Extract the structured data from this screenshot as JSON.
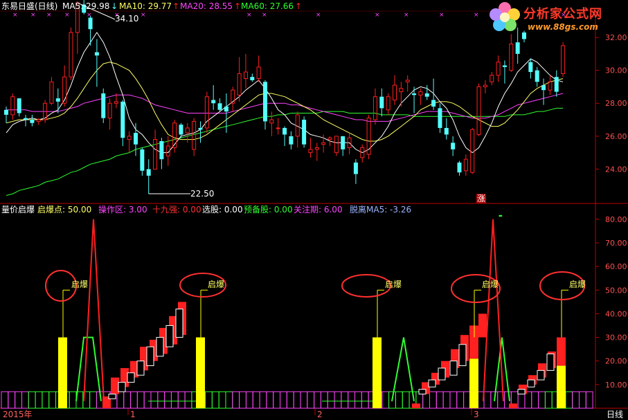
{
  "header": {
    "title": "东易日盛(日线)",
    "ma5": "MA5: 29.98",
    "ma10": "MA10: 29.77",
    "ma20": "MA20: 28.55",
    "ma60": "MA60: 27.66",
    "arrow_down": "↓",
    "arrow_up": "↑"
  },
  "logo": {
    "text": "分析家公式网",
    "url": "www.88gs.com"
  },
  "indicator_header": {
    "name": "量价启爆",
    "qibaodian": "启爆点: 50.00",
    "caozuoqu": "操作区: 3.00",
    "shijiuqiang": "十九强: 0.00",
    "xuangu": "选股: 0.00",
    "yubeigu": "预备股: 0.00",
    "guanzhuqi": "关注期: 6.00",
    "tuoli": "脱离MA5: -3.26"
  },
  "price_annotations": {
    "high": "34.10",
    "low": "22.50",
    "zhang": "涨"
  },
  "qibao_label": "启爆",
  "x_axis": {
    "year": "2015年",
    "m1": "1",
    "m2": "2",
    "m3": "3",
    "period": "日线"
  },
  "colors": {
    "up": "#ff2020",
    "down": "#54ffff",
    "ma5": "#ffffff",
    "ma10": "#ffff66",
    "ma20": "#ff44ff",
    "ma60": "#30ff30",
    "axis": "#c00000",
    "yellow": "#ffff00",
    "ring": "#ff3030"
  },
  "chart_data": [
    {
      "type": "candlestick",
      "yaxis": [
        "24.00",
        "26.00",
        "28.00",
        "30.00",
        "32.00"
      ],
      "ylim": [
        22,
        33.6
      ],
      "bars": [
        [
          27.6,
          27.8,
          26.8,
          27.3
        ],
        [
          27.3,
          28.6,
          27.0,
          28.4
        ],
        [
          28.3,
          28.3,
          27.2,
          27.4
        ],
        [
          27.1,
          27.3,
          26.6,
          27.0
        ],
        [
          27.0,
          27.3,
          26.6,
          26.8
        ],
        [
          26.9,
          27.1,
          26.7,
          27.0
        ],
        [
          27.0,
          28.2,
          26.8,
          28.0
        ],
        [
          28.0,
          29.6,
          27.9,
          29.3
        ],
        [
          28.3,
          28.9,
          27.4,
          28.1
        ],
        [
          28.0,
          30.3,
          27.8,
          29.6
        ],
        [
          29.6,
          32.6,
          29.4,
          32.3
        ],
        [
          32.3,
          34.2,
          31.0,
          34.1
        ],
        [
          34.0,
          34.3,
          33.4,
          33.5
        ],
        [
          33.2,
          33.3,
          31.5,
          32.5
        ],
        [
          31.1,
          31.9,
          29.0,
          30.9
        ],
        [
          28.6,
          28.9,
          26.8,
          27.1
        ],
        [
          27.1,
          28.3,
          26.4,
          28.0
        ],
        [
          28.0,
          28.6,
          27.7,
          28.1
        ],
        [
          28.1,
          28.2,
          25.4,
          25.9
        ],
        [
          25.8,
          26.3,
          25.0,
          26.0
        ],
        [
          26.2,
          26.8,
          24.8,
          25.5
        ],
        [
          25.2,
          25.3,
          23.6,
          23.9
        ],
        [
          24.0,
          24.6,
          22.5,
          23.6
        ],
        [
          24.0,
          26.4,
          24.0,
          25.8
        ],
        [
          25.7,
          25.9,
          24.0,
          24.6
        ],
        [
          24.8,
          26.0,
          24.2,
          25.4
        ],
        [
          25.3,
          27.0,
          25.0,
          26.8
        ],
        [
          26.7,
          26.8,
          25.9,
          26.1
        ],
        [
          26.2,
          26.8,
          25.6,
          26.5
        ],
        [
          25.2,
          27.1,
          24.8,
          26.9
        ],
        [
          26.5,
          26.9,
          25.6,
          26.4
        ],
        [
          26.5,
          28.7,
          26.2,
          28.4
        ],
        [
          28.2,
          29.1,
          27.6,
          28.0
        ],
        [
          28.0,
          28.3,
          27.5,
          27.6
        ],
        [
          27.8,
          28.6,
          26.2,
          27.5
        ],
        [
          28.0,
          29.0,
          27.5,
          28.8
        ],
        [
          28.5,
          30.8,
          28.1,
          29.8
        ],
        [
          29.5,
          31.0,
          28.9,
          29.9
        ],
        [
          29.6,
          29.8,
          29.3,
          29.4
        ],
        [
          29.5,
          30.9,
          29.3,
          30.2
        ],
        [
          29.3,
          29.4,
          26.4,
          26.9
        ],
        [
          26.8,
          27.5,
          26.0,
          27.0
        ],
        [
          26.5,
          27.1,
          26.1,
          26.5
        ],
        [
          26.5,
          26.6,
          25.4,
          26.1
        ],
        [
          26.0,
          26.3,
          25.2,
          25.5
        ],
        [
          26.0,
          27.5,
          25.3,
          27.3
        ],
        [
          27.0,
          27.2,
          25.3,
          25.5
        ],
        [
          25.0,
          25.9,
          24.7,
          25.2
        ],
        [
          25.2,
          25.6,
          24.5,
          25.3
        ],
        [
          25.5,
          26.1,
          25.0,
          25.6
        ],
        [
          25.8,
          26.0,
          25.4,
          25.9
        ],
        [
          25.0,
          26.0,
          24.8,
          26.0
        ],
        [
          26.0,
          25.6,
          24.8,
          25.2
        ],
        [
          25.3,
          26.2,
          24.9,
          25.9
        ],
        [
          24.4,
          24.6,
          23.1,
          23.7
        ],
        [
          24.7,
          25.5,
          24.4,
          25.3
        ],
        [
          24.9,
          27.3,
          24.6,
          27.1
        ],
        [
          27.0,
          28.9,
          26.7,
          28.4
        ],
        [
          28.4,
          28.9,
          27.2,
          27.7
        ],
        [
          27.6,
          28.6,
          27.3,
          28.4
        ],
        [
          28.2,
          29.7,
          27.9,
          29.1
        ],
        [
          28.7,
          29.3,
          27.8,
          28.9
        ],
        [
          29.3,
          29.7,
          28.7,
          29.4
        ],
        [
          28.6,
          29.0,
          27.4,
          28.5
        ],
        [
          28.5,
          28.9,
          27.9,
          28.7
        ],
        [
          28.6,
          29.1,
          28.2,
          28.4
        ],
        [
          28.2,
          29.5,
          27.6,
          27.8
        ],
        [
          27.7,
          28.0,
          26.2,
          26.5
        ],
        [
          26.5,
          27.1,
          25.8,
          26.1
        ],
        [
          25.6,
          26.0,
          24.8,
          25.2
        ],
        [
          24.4,
          24.5,
          23.6,
          23.8
        ],
        [
          23.9,
          24.9,
          23.6,
          24.6
        ],
        [
          23.8,
          26.5,
          23.7,
          26.4
        ],
        [
          26.1,
          29.2,
          26.0,
          29.0
        ],
        [
          29.0,
          29.4,
          28.6,
          29.1
        ],
        [
          29.3,
          29.9,
          29.1,
          29.7
        ],
        [
          29.7,
          30.9,
          29.3,
          30.5
        ],
        [
          30.3,
          30.6,
          29.2,
          30.2
        ],
        [
          30.0,
          32.2,
          29.9,
          31.6
        ],
        [
          31.7,
          32.6,
          30.4,
          31.0
        ],
        [
          32.3,
          32.4,
          31.7,
          31.9
        ],
        [
          30.5,
          30.7,
          29.5,
          29.9
        ],
        [
          30.0,
          30.2,
          29.0,
          29.3
        ],
        [
          29.1,
          29.5,
          27.9,
          28.8
        ],
        [
          28.8,
          29.7,
          28.5,
          29.3
        ],
        [
          29.6,
          30.0,
          28.4,
          28.7
        ],
        [
          29.8,
          31.7,
          29.6,
          31.5
        ]
      ],
      "ma5": [
        26.2,
        26.7,
        26.9,
        27.0,
        27.1,
        27.0,
        27.1,
        27.4,
        27.6,
        28.2,
        29.1,
        30.2,
        31.1,
        31.7,
        32.3,
        31.7,
        30.8,
        29.6,
        28.5,
        27.1,
        26.4,
        26.1,
        25.6,
        25.2,
        25.0,
        25.0,
        25.5,
        26.0,
        26.1,
        26.2,
        26.4,
        26.9,
        27.2,
        27.5,
        27.8,
        28.1,
        28.4,
        28.8,
        29.1,
        29.4,
        28.9,
        28.3,
        27.6,
        27.3,
        26.8,
        26.6,
        26.4,
        26.1,
        26.0,
        25.9,
        25.7,
        25.6,
        25.6,
        25.6,
        25.2,
        25.0,
        25.2,
        25.6,
        26.0,
        26.6,
        27.4,
        28.0,
        28.4,
        28.8,
        29.0,
        28.9,
        28.6,
        28.1,
        27.7,
        27.0,
        26.0,
        25.3,
        25.0,
        25.3,
        26.0,
        26.8,
        27.8,
        28.6,
        29.2,
        29.9,
        30.3,
        30.7,
        30.5,
        30.1,
        29.7,
        29.4,
        29.3
      ],
      "ma10": [
        26.8,
        26.9,
        27.0,
        27.0,
        27.0,
        27.0,
        27.0,
        27.1,
        27.2,
        27.4,
        27.8,
        28.3,
        28.9,
        29.5,
        30.0,
        30.4,
        30.5,
        30.4,
        30.2,
        30.0,
        29.5,
        28.9,
        28.2,
        27.4,
        26.7,
        26.1,
        25.9,
        25.8,
        25.8,
        25.8,
        25.9,
        26.1,
        26.4,
        26.7,
        27.0,
        27.3,
        27.6,
        27.9,
        28.2,
        28.5,
        28.6,
        28.6,
        28.5,
        28.4,
        28.2,
        28.0,
        27.8,
        27.6,
        27.3,
        27.0,
        26.8,
        26.6,
        26.4,
        26.2,
        26.0,
        25.8,
        25.7,
        25.7,
        25.8,
        26.0,
        26.3,
        26.6,
        26.9,
        27.2,
        27.6,
        27.8,
        28.0,
        28.1,
        28.1,
        28.0,
        27.8,
        27.5,
        27.2,
        27.0,
        26.8,
        26.6,
        26.6,
        26.8,
        27.2,
        27.6,
        28.1,
        28.6,
        28.9,
        29.1,
        29.3,
        29.4,
        29.5
      ],
      "ma20": [
        27.6,
        27.6,
        27.6,
        27.6,
        27.5,
        27.5,
        27.5,
        27.5,
        27.5,
        27.6,
        27.7,
        27.8,
        28.0,
        28.1,
        28.2,
        28.3,
        28.4,
        28.5,
        28.5,
        28.5,
        28.4,
        28.3,
        28.1,
        27.9,
        27.8,
        27.7,
        27.6,
        27.5,
        27.4,
        27.4,
        27.4,
        27.4,
        27.4,
        27.4,
        27.4,
        27.5,
        27.6,
        27.7,
        27.8,
        27.9,
        28.0,
        28.0,
        28.0,
        28.0,
        27.9,
        27.9,
        27.8,
        27.7,
        27.6,
        27.5,
        27.4,
        27.3,
        27.2,
        27.1,
        27.0,
        27.0,
        26.9,
        26.9,
        26.9,
        26.9,
        27.0,
        27.1,
        27.2,
        27.3,
        27.4,
        27.5,
        27.5,
        27.5,
        27.5,
        27.4,
        27.3,
        27.2,
        27.1,
        27.1,
        27.1,
        27.2,
        27.3,
        27.5,
        27.7,
        27.9,
        28.0,
        28.1,
        28.2,
        28.3,
        28.4,
        28.5,
        28.6
      ],
      "ma60": [
        22.4,
        22.5,
        22.7,
        22.8,
        22.9,
        23.0,
        23.2,
        23.3,
        23.4,
        23.6,
        23.8,
        23.9,
        24.1,
        24.3,
        24.4,
        24.5,
        24.6,
        24.8,
        24.9,
        25.0,
        25.2,
        25.3,
        25.4,
        25.5,
        25.6,
        25.7,
        25.8,
        25.9,
        26.0,
        26.1,
        26.2,
        26.3,
        26.4,
        26.5,
        26.6,
        26.7,
        26.8,
        26.9,
        27.0,
        27.1,
        27.2,
        27.2,
        27.3,
        27.3,
        27.4,
        27.4,
        27.4,
        27.4,
        27.4,
        27.5,
        27.5,
        27.5,
        27.5,
        27.4,
        27.4,
        27.4,
        27.4,
        27.4,
        27.3,
        27.3,
        27.3,
        27.3,
        27.3,
        27.2,
        27.2,
        27.2,
        27.2,
        27.2,
        27.2,
        27.2,
        27.2,
        27.2,
        27.2,
        27.2,
        27.2,
        27.2,
        27.2,
        27.2,
        27.3,
        27.3,
        27.3,
        27.4,
        27.5,
        27.5,
        27.6,
        27.7,
        27.7
      ]
    },
    {
      "type": "indicator",
      "yaxis": [
        "10.00",
        "20.00",
        "30.00",
        "40.00",
        "50.00",
        "60.00",
        "70.00",
        "80.00"
      ],
      "ylim": [
        0,
        82
      ],
      "qibao_bars_yellow": [
        [
          6,
          30
        ],
        [
          20,
          30
        ],
        [
          38,
          30
        ],
        [
          47,
          21
        ],
        [
          56,
          18
        ]
      ],
      "red_line_peaks": [
        [
          7,
          0
        ],
        [
          9,
          80
        ],
        [
          11,
          0
        ],
        [
          48,
          0
        ],
        [
          50,
          80
        ],
        [
          52,
          0
        ]
      ],
      "green_peaks": [
        [
          6,
          3
        ],
        [
          8,
          30
        ],
        [
          9,
          30
        ],
        [
          11,
          3
        ],
        [
          40,
          3
        ],
        [
          41,
          30
        ],
        [
          42,
          3
        ],
        [
          49,
          3
        ],
        [
          50,
          30
        ],
        [
          51,
          3
        ]
      ],
      "stair_candles": [
        [
          10,
          2,
          4,
          0
        ],
        [
          11,
          7,
          10,
          1
        ],
        [
          12,
          9,
          13,
          1
        ],
        [
          13,
          13,
          17,
          0
        ],
        [
          14,
          16,
          20,
          1
        ],
        [
          15,
          20,
          26,
          0
        ],
        [
          16,
          23,
          30,
          0
        ],
        [
          17,
          27,
          36,
          1
        ],
        [
          18,
          31,
          42,
          1
        ],
        [
          19,
          35,
          45,
          0
        ],
        [
          42,
          0,
          2,
          0
        ],
        [
          43,
          7,
          10,
          1
        ],
        [
          44,
          10,
          14,
          0
        ],
        [
          45,
          14,
          19,
          1
        ],
        [
          46,
          17,
          25,
          1
        ],
        [
          47,
          22,
          35,
          0
        ],
        [
          48,
          30,
          46,
          0
        ],
        [
          52,
          0,
          3,
          0
        ],
        [
          53,
          7,
          10,
          1
        ],
        [
          54,
          10,
          14,
          0
        ],
        [
          55,
          14,
          19,
          1
        ],
        [
          56,
          18,
          30,
          0
        ]
      ]
    }
  ]
}
